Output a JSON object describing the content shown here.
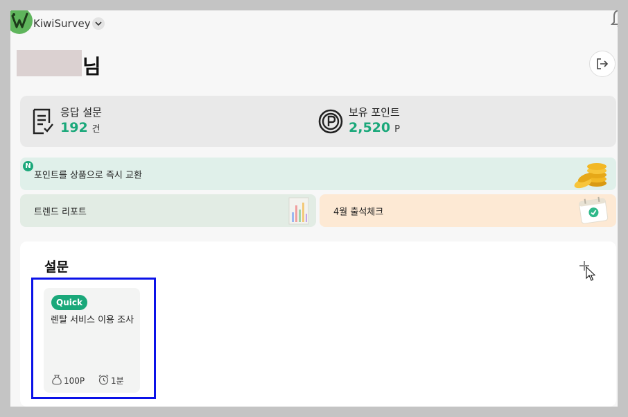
{
  "header": {
    "brand_name": "KiwiSurvey",
    "user_suffix": "님"
  },
  "stats": {
    "responses_label": "응답 설문",
    "responses_value": "192",
    "responses_unit": "건",
    "points_label": "보유 포인트",
    "points_value": "2,520",
    "points_unit": "P"
  },
  "banners": {
    "new_badge": "N",
    "exchange_text": "포인트를 상품으로 즉시 교환",
    "trend_text": "트렌드 리포트",
    "attendance_text": "4월 출석체크"
  },
  "surveys": {
    "title": "설문",
    "cards": [
      {
        "badge": "Quick",
        "title": "렌탈 서비스 이용 조사",
        "reward": "100P",
        "duration": "1분"
      }
    ]
  },
  "colors": {
    "accent": "#1aa87a",
    "highlight_outline": "#0b12e8",
    "exchange_bg": "#e0f0ea",
    "trend_bg": "#e2ece4",
    "attendance_bg": "#fde9d4"
  },
  "icons": [
    "kiwi-logo-icon",
    "chevron-down-icon",
    "bell-icon",
    "logout-icon",
    "survey-doc-icon",
    "point-coin-icon",
    "coins-stack-icon",
    "report-chart-icon",
    "calendar-check-icon",
    "plus-icon",
    "cursor-icon",
    "money-bag-icon",
    "clock-icon"
  ]
}
